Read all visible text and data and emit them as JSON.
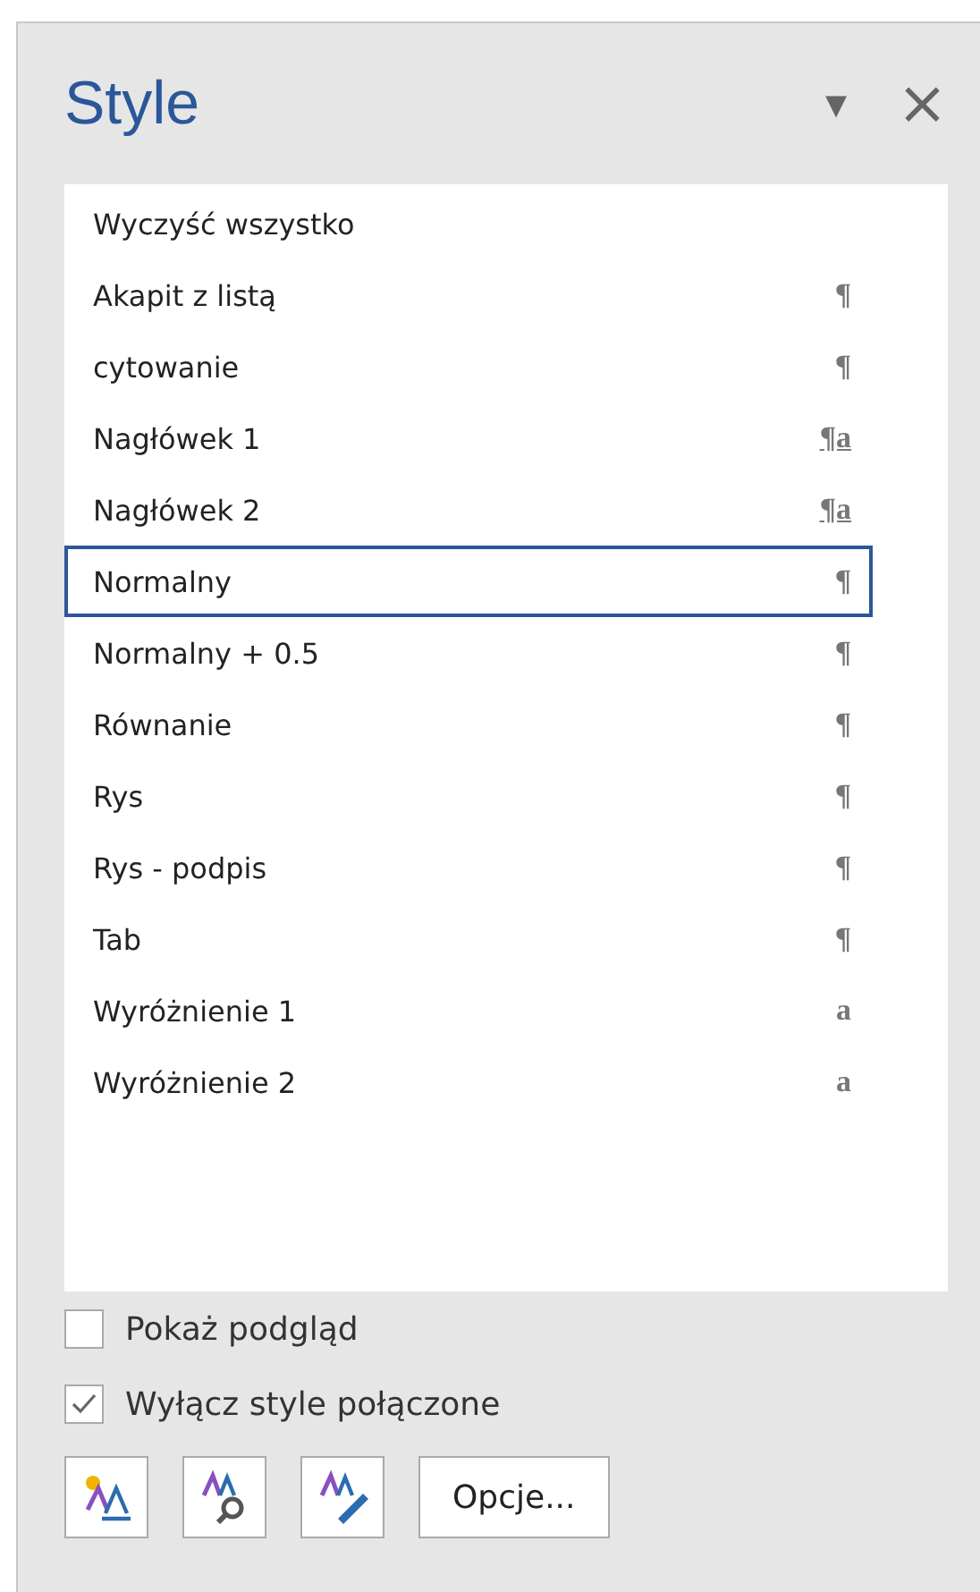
{
  "pane": {
    "title": "Style",
    "menu_glyph": "▾",
    "close_glyph": "×"
  },
  "styles": [
    {
      "name": "Wyczyść wszystko",
      "kind": "clear",
      "selected": false
    },
    {
      "name": "Akapit z listą",
      "kind": "paragraph",
      "mark": "¶",
      "selected": false
    },
    {
      "name": "cytowanie",
      "kind": "paragraph",
      "mark": "¶",
      "selected": false
    },
    {
      "name": "Nagłówek 1",
      "kind": "linked",
      "mark": "¶a",
      "selected": false
    },
    {
      "name": "Nagłówek 2",
      "kind": "linked",
      "mark": "¶a",
      "selected": false
    },
    {
      "name": "Normalny",
      "kind": "paragraph",
      "mark": "¶",
      "selected": true
    },
    {
      "name": "Normalny + 0.5",
      "kind": "paragraph",
      "mark": "¶",
      "selected": false
    },
    {
      "name": "Równanie",
      "kind": "paragraph",
      "mark": "¶",
      "selected": false
    },
    {
      "name": "Rys",
      "kind": "paragraph",
      "mark": "¶",
      "selected": false
    },
    {
      "name": "Rys - podpis",
      "kind": "paragraph",
      "mark": "¶",
      "selected": false
    },
    {
      "name": "Tab",
      "kind": "paragraph",
      "mark": "¶",
      "selected": false
    },
    {
      "name": "Wyróżnienie 1",
      "kind": "character",
      "mark": "a",
      "selected": false
    },
    {
      "name": "Wyróżnienie 2",
      "kind": "character",
      "mark": "a",
      "selected": false
    }
  ],
  "options": [
    {
      "label": "Pokaż podgląd",
      "checked": false
    },
    {
      "label": "Wyłącz style połączone",
      "checked": true
    }
  ],
  "buttons": [
    {
      "kind": "new-style"
    },
    {
      "kind": "style-inspector"
    },
    {
      "kind": "manage-styles"
    },
    {
      "kind": "text",
      "label": "Opcje..."
    }
  ]
}
